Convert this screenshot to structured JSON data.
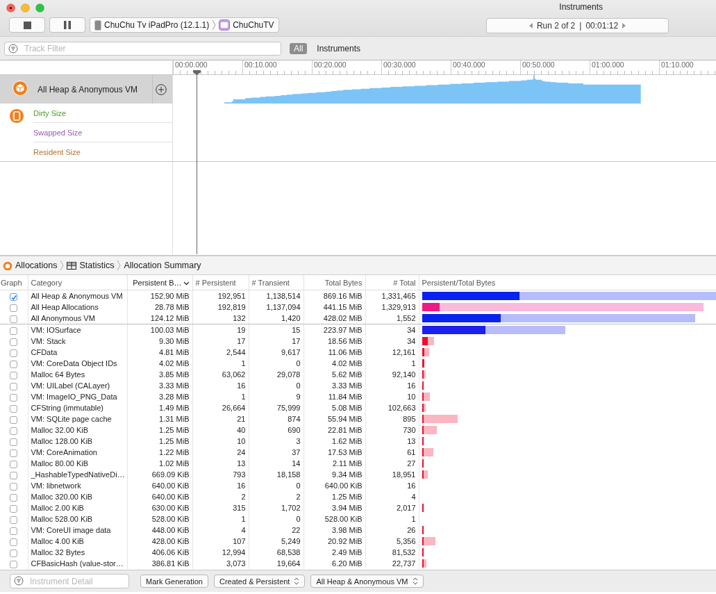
{
  "window": {
    "title": "Instruments"
  },
  "toolbar": {
    "device": "ChuChu Tv iPadPro (12.1.1)",
    "app": "ChuChuTV",
    "run": "Run 2 of 2",
    "separator": "|",
    "time": "00:01:12"
  },
  "filter_bar": {
    "placeholder": "Track Filter",
    "scopes": [
      {
        "label": "All",
        "selected": true
      },
      {
        "label": "Instruments",
        "selected": false
      }
    ]
  },
  "ruler": {
    "ticks": [
      "00:00.000",
      "00:10.000",
      "00:20.000",
      "00:30.000",
      "00:40.000",
      "00:50.000",
      "01:00.000",
      "01:10.000"
    ]
  },
  "tracks": [
    {
      "kind": "allocations",
      "label": "All Heap & Anonymous VM",
      "selected": true
    },
    {
      "kind": "vm-tracker",
      "selected": false,
      "series": [
        {
          "label": "Dirty Size",
          "color": "#4f9a2c"
        },
        {
          "label": "Swapped Size",
          "color": "#9a55b0"
        },
        {
          "label": "Resident Size",
          "color": "#b0732c"
        }
      ]
    }
  ],
  "breadcrumb": [
    "Allocations",
    "Statistics",
    "Allocation Summary"
  ],
  "table": {
    "columns": [
      {
        "label": "Graph",
        "sorted": false
      },
      {
        "label": "Category",
        "sorted": false
      },
      {
        "label": "Persistent B…",
        "sorted": true
      },
      {
        "label": "# Persistent",
        "sorted": false
      },
      {
        "label": "# Transient",
        "sorted": false
      },
      {
        "label": "Total Bytes",
        "sorted": false
      },
      {
        "label": "# Total",
        "sorted": false
      },
      {
        "label": "Persistent/Total Bytes",
        "sorted": false
      }
    ],
    "rows": [
      {
        "kind": "summary",
        "graph": true,
        "category": "All Heap & Anonymous VM",
        "persistent_bytes": "152.90 MiB",
        "persistent": "192,951",
        "transient": "1,138,514",
        "total_bytes": "869.16 MiB",
        "total": "1,331,465",
        "color": "#0a22f0",
        "persistent_bar": {
          "level": 0.33
        },
        "total_bar": {
          "level": 1.0
        }
      },
      {
        "kind": "summary",
        "graph": false,
        "category": "All Heap Allocations",
        "persistent_bytes": "28.78 MiB",
        "persistent": "192,819",
        "transient": "1,137,094",
        "total_bytes": "441.15 MiB",
        "total": "1,329,913",
        "color": "#ee1a86",
        "persistent_bar": {
          "level": 0.061
        },
        "total_bar": {
          "level": 0.955
        }
      },
      {
        "kind": "summary",
        "graph": false,
        "category": "All Anonymous VM",
        "persistent_bytes": "124.12 MiB",
        "persistent": "132",
        "transient": "1,420",
        "total_bytes": "428.02 MiB",
        "total": "1,552",
        "color": "#0a22f0",
        "persistent_bar": {
          "level": 0.268
        },
        "total_bar": {
          "level": 0.927
        }
      },
      {
        "kind": "category",
        "graph": false,
        "category": "VM: IOSurface",
        "persistent_bytes": "100.03 MiB",
        "persistent": "19",
        "transient": "15",
        "total_bytes": "223.97 MiB",
        "total": "34",
        "color": "#1a20ee",
        "persistent_bar": {
          "level": 0.216
        },
        "total_bar": {
          "level": 0.485
        }
      },
      {
        "kind": "category",
        "graph": false,
        "category": "VM: Stack",
        "persistent_bytes": "9.30 MiB",
        "persistent": "17",
        "transient": "17",
        "total_bytes": "18.56 MiB",
        "total": "34",
        "color": "#f00c2c",
        "persistent_bar": {
          "level": 0.019
        },
        "total_bar": {
          "level": 0.04
        }
      },
      {
        "kind": "category",
        "graph": false,
        "category": "CFData",
        "persistent_bytes": "4.81 MiB",
        "persistent": "2,544",
        "transient": "9,617",
        "total_bytes": "11.06 MiB",
        "total": "12,161",
        "color": "#f00c2c",
        "persistent_bar": {
          "level": 0.009
        },
        "total_bar": {
          "level": 0.024
        }
      },
      {
        "kind": "category",
        "graph": false,
        "category": "VM: CoreData Object IDs",
        "persistent_bytes": "4.02 MiB",
        "persistent": "1",
        "transient": "0",
        "total_bytes": "4.02 MiB",
        "total": "1",
        "color": "#f00c2c",
        "persistent_bar": {
          "level": 0.008
        },
        "total_bar": {
          "level": 0.009
        }
      },
      {
        "kind": "category",
        "graph": false,
        "category": "Malloc 64 Bytes",
        "persistent_bytes": "3.85 MiB",
        "persistent": "63,062",
        "transient": "29,078",
        "total_bytes": "5.62 MiB",
        "total": "92,140",
        "color": "#f00c2c",
        "persistent_bar": {
          "level": 0.007
        },
        "total_bar": {
          "level": 0.012
        }
      },
      {
        "kind": "category",
        "graph": false,
        "category": "VM: UILabel (CALayer)",
        "persistent_bytes": "3.33 MiB",
        "persistent": "16",
        "transient": "0",
        "total_bytes": "3.33 MiB",
        "total": "16",
        "color": "#f00c2c",
        "persistent_bar": {
          "level": 0.007
        },
        "total_bar": {
          "level": 0.007
        }
      },
      {
        "kind": "category",
        "graph": false,
        "category": "VM: ImageIO_PNG_Data",
        "persistent_bytes": "3.28 MiB",
        "persistent": "1",
        "transient": "9",
        "total_bytes": "11.84 MiB",
        "total": "10",
        "color": "#f00c2c",
        "persistent_bar": {
          "level": 0.007
        },
        "total_bar": {
          "level": 0.026
        }
      },
      {
        "kind": "category",
        "graph": false,
        "category": "CFString (immutable)",
        "persistent_bytes": "1.49 MiB",
        "persistent": "26,664",
        "transient": "75,999",
        "total_bytes": "5.08 MiB",
        "total": "102,663",
        "color": "#f00c2c",
        "persistent_bar": {
          "level": 0.003
        },
        "total_bar": {
          "level": 0.012
        }
      },
      {
        "kind": "category",
        "graph": false,
        "category": "VM: SQLite page cache",
        "persistent_bytes": "1.31 MiB",
        "persistent": "21",
        "transient": "874",
        "total_bytes": "55.94 MiB",
        "total": "895",
        "color": "#f00c2c",
        "persistent_bar": {
          "level": 0.003
        },
        "total_bar": {
          "level": 0.122
        }
      },
      {
        "kind": "category",
        "graph": false,
        "category": "Malloc 32.00 KiB",
        "persistent_bytes": "1.25 MiB",
        "persistent": "40",
        "transient": "690",
        "total_bytes": "22.81 MiB",
        "total": "730",
        "color": "#f00c2c",
        "persistent_bar": {
          "level": 0.003
        },
        "total_bar": {
          "level": 0.05
        }
      },
      {
        "kind": "category",
        "graph": false,
        "category": "Malloc 128.00 KiB",
        "persistent_bytes": "1.25 MiB",
        "persistent": "10",
        "transient": "3",
        "total_bytes": "1.62 MiB",
        "total": "13",
        "color": "#f00c2c",
        "persistent_bar": {
          "level": 0.003
        },
        "total_bar": {
          "level": 0.004
        }
      },
      {
        "kind": "category",
        "graph": false,
        "category": "VM: CoreAnimation",
        "persistent_bytes": "1.22 MiB",
        "persistent": "24",
        "transient": "37",
        "total_bytes": "17.53 MiB",
        "total": "61",
        "color": "#f00c2c",
        "persistent_bar": {
          "level": 0.003
        },
        "total_bar": {
          "level": 0.038
        }
      },
      {
        "kind": "category",
        "graph": false,
        "category": "Malloc 80.00 KiB",
        "persistent_bytes": "1.02 MiB",
        "persistent": "13",
        "transient": "14",
        "total_bytes": "2.11 MiB",
        "total": "27",
        "color": "#f00c2c",
        "persistent_bar": {
          "level": 0.002
        },
        "total_bar": {
          "level": 0.004
        }
      },
      {
        "kind": "category",
        "graph": false,
        "category": "_HashableTypedNativeDi…",
        "persistent_bytes": "669.09 KiB",
        "persistent": "793",
        "transient": "18,158",
        "total_bytes": "9.34 MiB",
        "total": "18,951",
        "color": "#f00c2c",
        "persistent_bar": {
          "level": 0.001
        },
        "total_bar": {
          "level": 0.019
        }
      },
      {
        "kind": "category",
        "graph": false,
        "category": "VM: libnetwork",
        "persistent_bytes": "640.00 KiB",
        "persistent": "16",
        "transient": "0",
        "total_bytes": "640.00 KiB",
        "total": "16"
      },
      {
        "kind": "category",
        "graph": false,
        "category": "Malloc 320.00 KiB",
        "persistent_bytes": "640.00 KiB",
        "persistent": "2",
        "transient": "2",
        "total_bytes": "1.25 MiB",
        "total": "4"
      },
      {
        "kind": "category",
        "graph": false,
        "category": "Malloc 2.00 KiB",
        "persistent_bytes": "630.00 KiB",
        "persistent": "315",
        "transient": "1,702",
        "total_bytes": "3.94 MiB",
        "total": "2,017",
        "color": "#f00c2c",
        "persistent_bar": {
          "level": 0.001
        },
        "total_bar": {
          "level": 0.007
        }
      },
      {
        "kind": "category",
        "graph": false,
        "category": "Malloc 528.00 KiB",
        "persistent_bytes": "528.00 KiB",
        "persistent": "1",
        "transient": "0",
        "total_bytes": "528.00 KiB",
        "total": "1"
      },
      {
        "kind": "category",
        "graph": false,
        "category": "VM: CoreUI image data",
        "persistent_bytes": "448.00 KiB",
        "persistent": "4",
        "transient": "22",
        "total_bytes": "3.98 MiB",
        "total": "26",
        "color": "#f00c2c",
        "persistent_bar": {
          "level": 0.001
        },
        "total_bar": {
          "level": 0.007
        }
      },
      {
        "kind": "category",
        "graph": false,
        "category": "Malloc 4.00 KiB",
        "persistent_bytes": "428.00 KiB",
        "persistent": "107",
        "transient": "5,249",
        "total_bytes": "20.92 MiB",
        "total": "5,356",
        "color": "#f00c2c",
        "persistent_bar": {
          "level": 0.001
        },
        "total_bar": {
          "level": 0.045
        }
      },
      {
        "kind": "category",
        "graph": false,
        "category": "Malloc 32 Bytes",
        "persistent_bytes": "406.06 KiB",
        "persistent": "12,994",
        "transient": "68,538",
        "total_bytes": "2.49 MiB",
        "total": "81,532",
        "color": "#f00c2c",
        "persistent_bar": {
          "level": 0.001
        },
        "total_bar": {
          "level": 0.005
        }
      },
      {
        "kind": "category",
        "graph": false,
        "category": "CFBasicHash (value-stor…",
        "persistent_bytes": "386.81 KiB",
        "persistent": "3,073",
        "transient": "19,664",
        "total_bytes": "6.20 MiB",
        "total": "22,737",
        "color": "#f00c2c",
        "persistent_bar": {
          "level": 0.001
        },
        "total_bar": {
          "level": 0.015
        }
      }
    ]
  },
  "bottom_bar": {
    "placeholder": "Instrument Detail",
    "button": "Mark Generation",
    "popups": [
      "Created & Persistent",
      "All Heap & Anonymous VM"
    ]
  }
}
